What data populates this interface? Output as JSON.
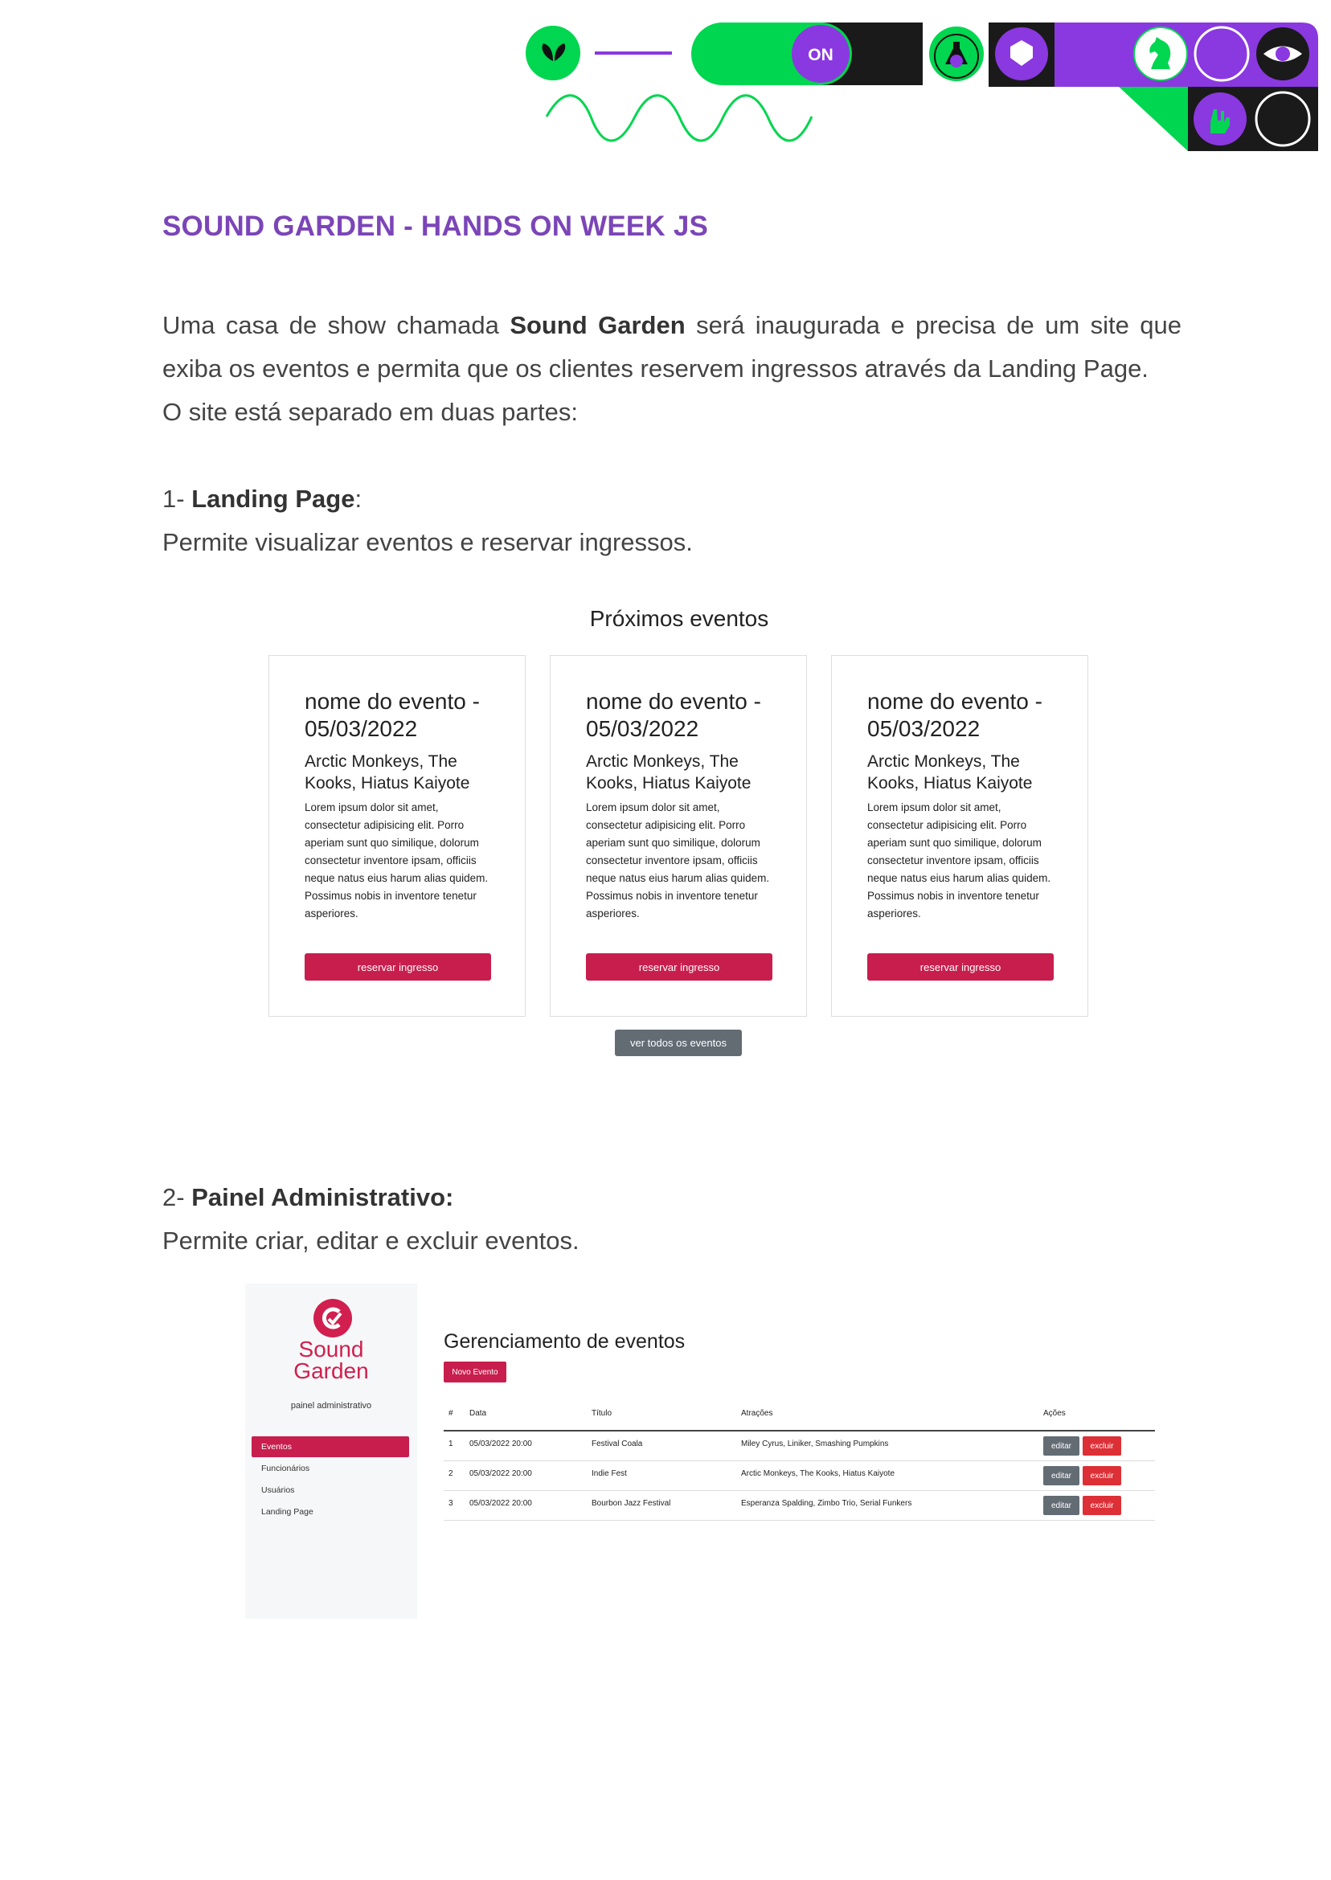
{
  "colors": {
    "purple": "#8a38e0",
    "green": "#00d64f",
    "black": "#1a1a1a",
    "accent_red": "#c81e4d",
    "title_purple": "#7b45b8"
  },
  "header": {
    "toggle_label": "ON"
  },
  "doc": {
    "title": "SOUND GARDEN - HANDS ON WEEK JS",
    "intro_1": "Uma casa de show chamada ",
    "intro_bold": "Sound Garden",
    "intro_2": " será inaugurada e precisa de um site que exiba os eventos e permita que os clientes reservem ingressos através da Landing Page.",
    "intro_3": "O site está separado em duas partes:",
    "section1": {
      "num": "1- ",
      "title": "Landing Page",
      "suffix": ":",
      "desc": "Permite visualizar eventos e reservar ingressos."
    },
    "section2": {
      "num": "2- ",
      "title": "Painel Administrativo:",
      "desc": "Permite criar, editar e excluir eventos."
    }
  },
  "landing": {
    "heading": "Próximos eventos",
    "cards": [
      {
        "name": "nome do evento - 05/03/2022",
        "bands": "Arctic Monkeys, The Kooks, Hiatus Kaiyote",
        "desc": "Lorem ipsum dolor sit amet, consectetur adipisicing elit. Porro aperiam sunt quo similique, dolorum consectetur inventore ipsam, officiis neque natus eius harum alias quidem. Possimus nobis in inventore tenetur asperiores.",
        "button": "reservar ingresso"
      },
      {
        "name": "nome do evento - 05/03/2022",
        "bands": "Arctic Monkeys, The Kooks, Hiatus Kaiyote",
        "desc": "Lorem ipsum dolor sit amet, consectetur adipisicing elit. Porro aperiam sunt quo similique, dolorum consectetur inventore ipsam, officiis neque natus eius harum alias quidem. Possimus nobis in inventore tenetur asperiores.",
        "button": "reservar ingresso"
      },
      {
        "name": "nome do evento - 05/03/2022",
        "bands": "Arctic Monkeys, The Kooks, Hiatus Kaiyote",
        "desc": "Lorem ipsum dolor sit amet, consectetur adipisicing elit. Porro aperiam sunt quo similique, dolorum consectetur inventore ipsam, officiis neque natus eius harum alias quidem. Possimus nobis in inventore tenetur asperiores.",
        "button": "reservar ingresso"
      }
    ],
    "see_all": "ver todos os eventos"
  },
  "admin": {
    "logo_line1": "Sound",
    "logo_line2": "Garden",
    "subtitle": "painel administrativo",
    "nav": [
      "Eventos",
      "Funcionários",
      "Usuários",
      "Landing Page"
    ],
    "title": "Gerenciamento de eventos",
    "new_button": "Novo Evento",
    "columns": [
      "#",
      "Data",
      "Título",
      "Atrações",
      "Ações"
    ],
    "rows": [
      {
        "id": "1",
        "date": "05/03/2022 20:00",
        "title": "Festival Coala",
        "attractions": "Miley Cyrus, Liniker, Smashing Pumpkins",
        "edit": "editar",
        "delete": "excluir"
      },
      {
        "id": "2",
        "date": "05/03/2022 20:00",
        "title": "Indie Fest",
        "attractions": "Arctic Monkeys, The Kooks, Hiatus Kaiyote",
        "edit": "editar",
        "delete": "excluir"
      },
      {
        "id": "3",
        "date": "05/03/2022 20:00",
        "title": "Bourbon Jazz Festival",
        "attractions": "Esperanza Spalding, Zimbo Trio, Serial Funkers",
        "edit": "editar",
        "delete": "excluir"
      }
    ]
  }
}
